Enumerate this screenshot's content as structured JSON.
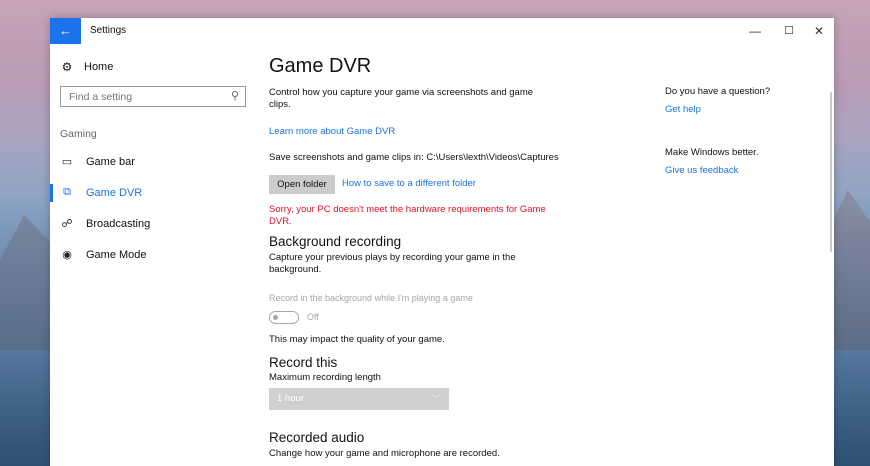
{
  "window": {
    "title": "Settings",
    "back_icon": "back-arrow-icon",
    "controls": {
      "minimize": "—",
      "maximize": "☐",
      "close": "✕"
    }
  },
  "sidebar": {
    "home_label": "Home",
    "search_placeholder": "Find a setting",
    "section": "Gaming",
    "items": [
      {
        "label": "Game bar",
        "icon": "game-bar-icon",
        "glyph": "▭",
        "active": false
      },
      {
        "label": "Game DVR",
        "icon": "game-dvr-icon",
        "glyph": "⧉",
        "active": true
      },
      {
        "label": "Broadcasting",
        "icon": "broadcasting-icon",
        "glyph": "☍",
        "active": false
      },
      {
        "label": "Game Mode",
        "icon": "game-mode-icon",
        "glyph": "◉",
        "active": false
      }
    ]
  },
  "main": {
    "title": "Game DVR",
    "intro": "Control how you capture your game via screenshots and game clips.",
    "learn_more": "Learn more about Game DVR",
    "save_path_text": "Save screenshots and game clips in: C:\\Users\\lexth\\Videos\\Captures",
    "open_folder_label": "Open folder",
    "save_link": "How to save to a different folder",
    "error_text": "Sorry, your PC doesn't meet the hardware requirements for Game DVR.",
    "background_recording": {
      "heading": "Background recording",
      "description": "Capture your previous plays by recording your game in the background.",
      "toggle_caption": "Record in the background while I'm playing a game",
      "toggle_state": "Off",
      "impact_note": "This may impact the quality of your game."
    },
    "record_this": {
      "heading": "Record this",
      "max_length_label": "Maximum recording length",
      "max_length_value": "1 hour"
    },
    "recorded_audio": {
      "heading": "Recorded audio",
      "description": "Change how your game and microphone are recorded."
    }
  },
  "right": {
    "question": "Do you have a question?",
    "help_link": "Get help",
    "better": "Make Windows better.",
    "feedback_link": "Give us feedback"
  },
  "colors": {
    "accent": "#1a73e8",
    "error": "#e81123"
  }
}
